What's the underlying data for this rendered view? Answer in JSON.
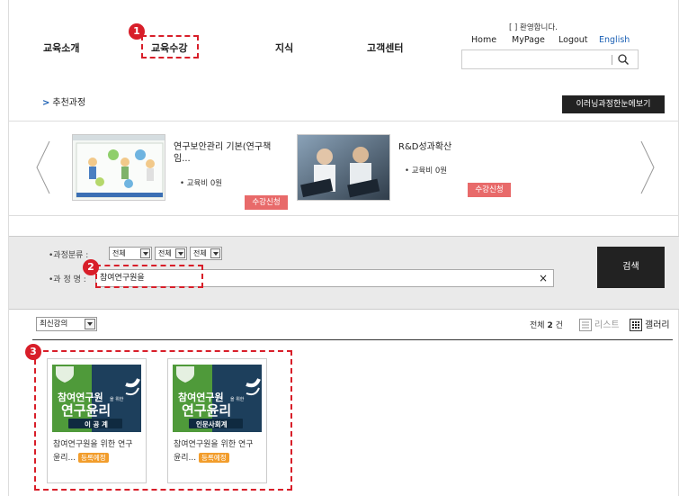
{
  "header": {
    "welcome": "[        ] 환영합니다.",
    "nav": [
      "교육소개",
      "교육수강",
      "지식",
      "고객센터"
    ],
    "util": [
      "Home",
      "MyPage",
      "Logout",
      "English"
    ],
    "search_value": ""
  },
  "markers": [
    "1",
    "2",
    "3"
  ],
  "recommend": {
    "title": "추천과정",
    "arrow": ">",
    "preview_button": "이러닝과정한눈에보기",
    "courses": [
      {
        "title_line1": "연구보안관리 기본(연구책",
        "title_line2": "임...",
        "fee": "교육비 0원",
        "enroll": "수강신청"
      },
      {
        "title_line1": "R&D성과확산",
        "title_line2": "",
        "fee": "교육비 0원",
        "enroll": "수강신청"
      }
    ]
  },
  "filter": {
    "category_label": "•과정분류 :",
    "category_selects": [
      "전체",
      "전체",
      "전체"
    ],
    "name_label": "•과 정 명 :",
    "keyword": "참여연구원을",
    "clear": "×",
    "search_button": "검색"
  },
  "list": {
    "sort_value": "최신강의",
    "total_prefix": "전체",
    "total_count": "2",
    "total_suffix": "건",
    "view_list": "리스트",
    "view_gallery": "갤러리",
    "cards": [
      {
        "img_line1": "참여연구원",
        "img_small": "을 위한",
        "img_line2": "연구윤리",
        "img_band": "이 공 계",
        "title": "참여연구원을 위한 연구",
        "title2": "윤리...",
        "tag": "등록예정"
      },
      {
        "img_line1": "참여연구원",
        "img_small": "을 위한",
        "img_line2": "연구윤리",
        "img_band": "인문사회계",
        "title": "참여연구원을 위한 연구",
        "title2": "윤리...",
        "tag": "등록예정"
      }
    ]
  },
  "colors": {
    "accent": "#d81e29",
    "link": "#1a5fb4",
    "card_green": "#4f9a3a",
    "card_navy": "#1d3f5c",
    "tag": "#f29d2c",
    "enroll": "#e86a6a"
  }
}
